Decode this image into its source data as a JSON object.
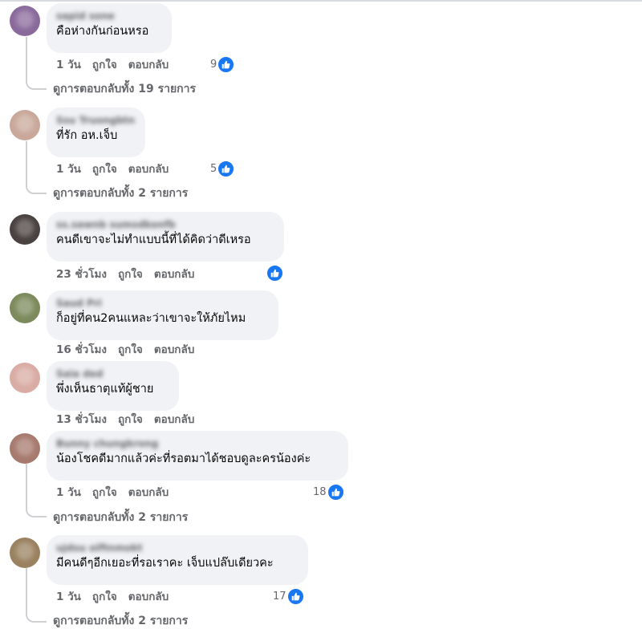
{
  "comments": [
    {
      "author": "sapid sone",
      "text": "คือห่างกันก่อนหรอ",
      "time": "1 วัน",
      "like": "ถูกใจ",
      "reply": "ตอบกลับ",
      "reactions": "9",
      "view_replies": "ดูการตอบกลับทั้ง 19 รายการ",
      "avatar_color": "#8a6a9c"
    },
    {
      "author": "Ssu Truongbtn",
      "text": "ที่รัก อห.เจ็บ",
      "time": "1 วัน",
      "like": "ถูกใจ",
      "reply": "ตอบกลับ",
      "reactions": "5",
      "view_replies": "ดูการตอบกลับทั้ง 2 รายการ",
      "avatar_color": "#c9a89a"
    },
    {
      "author": "ss.sawnb sumsdkonfb",
      "text": "คนดีเขาจะไม่ทำแบบนี้ที่ได้คิดว่าดีเหรอ",
      "time": "23 ชั่วโมง",
      "like": "ถูกใจ",
      "reply": "ตอบกลับ",
      "reactions": "",
      "view_replies": "",
      "avatar_color": "#4a4240"
    },
    {
      "author": "Saud Pri",
      "text": "ก็อยู่ที่คน2คนแหละว่าเขาจะให้ภัยไหม",
      "time": "16 ชั่วโมง",
      "like": "ถูกใจ",
      "reply": "ตอบกลับ",
      "reactions": "",
      "view_replies": "",
      "avatar_color": "#7c8a5c"
    },
    {
      "author": "Saia ded",
      "text": "พึ่งเห็นธาตุแท้ผู้ชาย",
      "time": "13 ชั่วโมง",
      "like": "ถูกใจ",
      "reply": "ตอบกลับ",
      "reactions": "",
      "view_replies": "",
      "avatar_color": "#d9aca4"
    },
    {
      "author": "Bunny chungkrong",
      "text": "น้องโชคดีมากแล้วค่ะที่รอตมาได้ชอบดูละครน้องค่ะ",
      "time": "1 วัน",
      "like": "ถูกใจ",
      "reply": "ตอบกลับ",
      "reactions": "18",
      "view_replies": "ดูการตอบกลับทั้ง 2 รายการ",
      "avatar_color": "#a77a6e"
    },
    {
      "author": "ujdsu oiftnmokt",
      "text": "มีคนดีๆอีกเยอะที่รอเราคะ เจ็บแปล๊บเดียวคะ",
      "time": "1 วัน",
      "like": "ถูกใจ",
      "reply": "ตอบกลับ",
      "reactions": "17",
      "view_replies": "ดูการตอบกลับทั้ง 2 รายการ",
      "avatar_color": "#9a8260"
    }
  ],
  "colors": {
    "bubble": "#f0f2f5",
    "meta": "#65676b",
    "like_blue": "#1877f2"
  }
}
